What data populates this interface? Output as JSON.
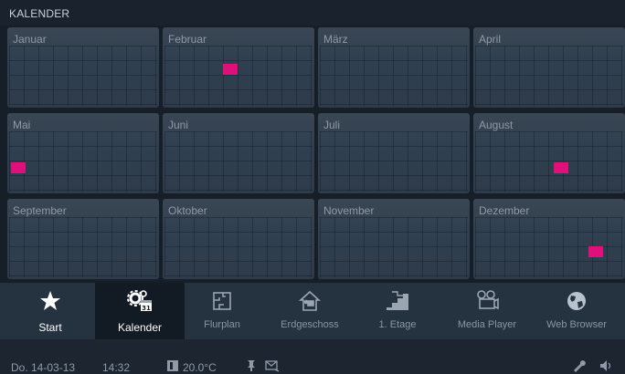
{
  "header": {
    "title": "KALENDER"
  },
  "months": [
    "Januar",
    "Februar",
    "März",
    "April",
    "Mai",
    "Juni",
    "Juli",
    "August",
    "September",
    "Oktober",
    "November",
    "Dezember"
  ],
  "nav": [
    {
      "label": "Start",
      "icon": "star-icon"
    },
    {
      "label": "Kalender",
      "icon": "gear-calendar-icon"
    },
    {
      "label": "Flurplan",
      "icon": "floorplan-icon"
    },
    {
      "label": "Erdgeschoss",
      "icon": "house-icon"
    },
    {
      "label": "1. Etage",
      "icon": "stairs-icon"
    },
    {
      "label": "Media Player",
      "icon": "film-icon"
    },
    {
      "label": "Web Browser",
      "icon": "globe-icon"
    }
  ],
  "status": {
    "date": "Do. 14-03-13",
    "time": "14:32",
    "temperature": "20.0°C"
  },
  "colors": {
    "event": "#e0107a",
    "active_nav": "#121b24"
  }
}
